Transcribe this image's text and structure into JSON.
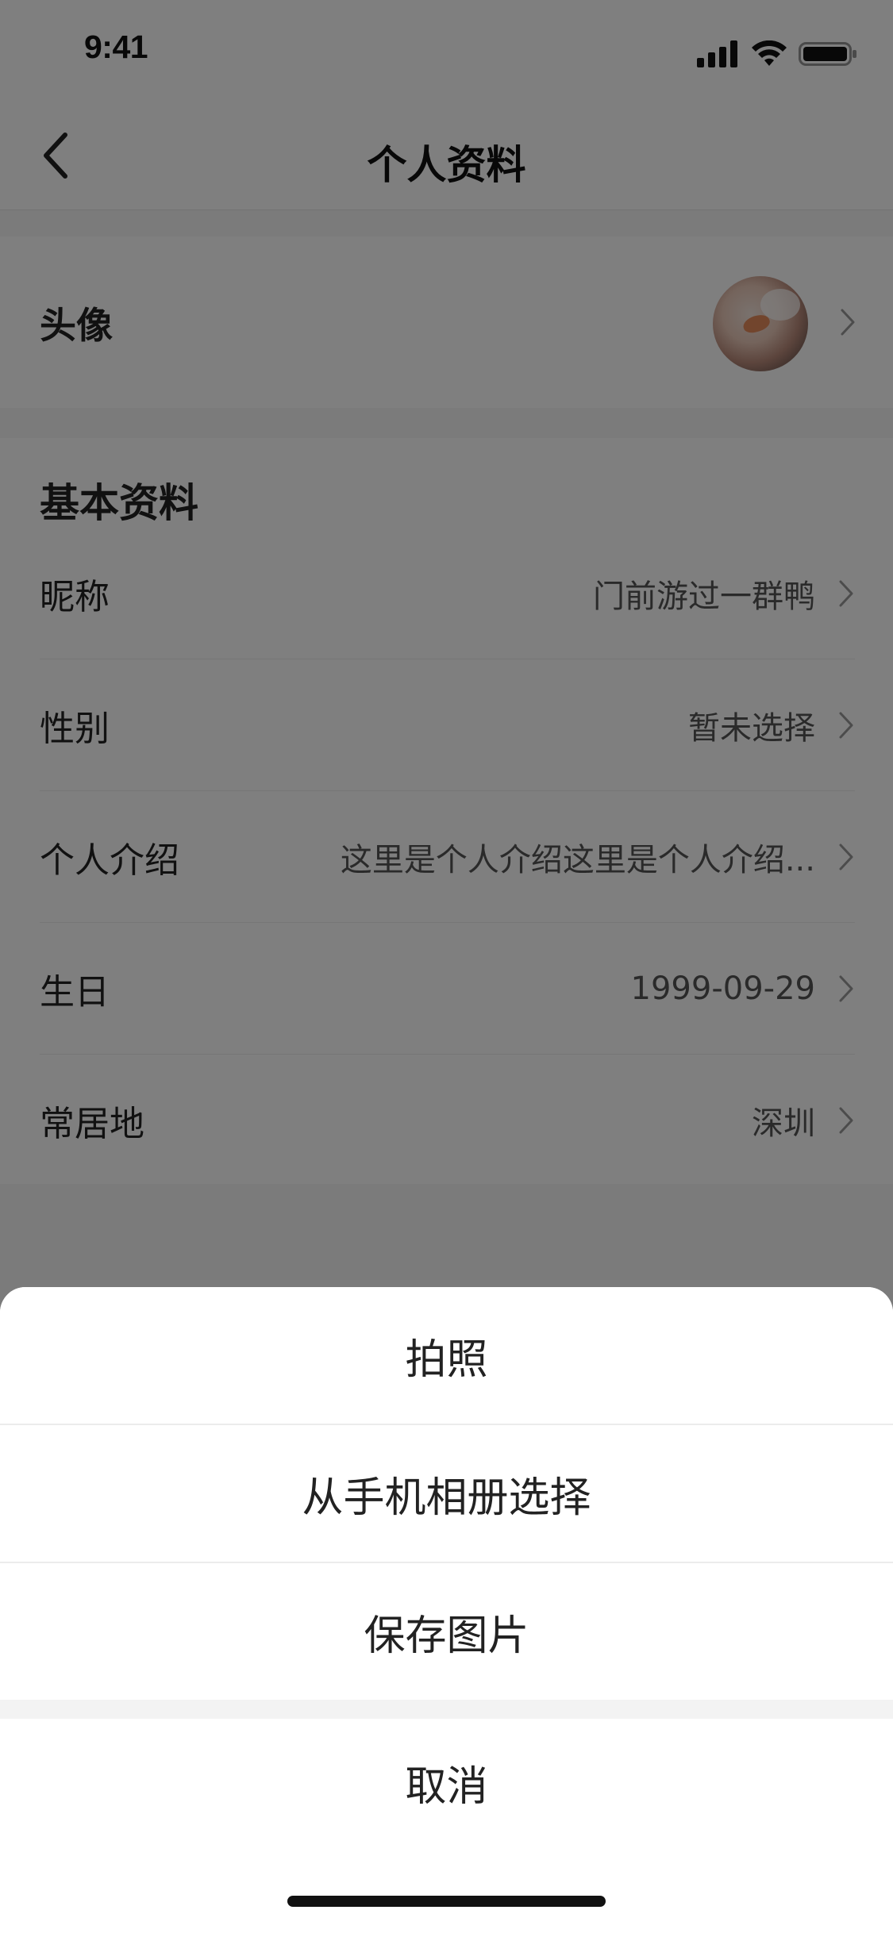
{
  "status_bar": {
    "time": "9:41",
    "icons": [
      "cellular-signal-icon",
      "wifi-icon",
      "battery-icon"
    ]
  },
  "nav": {
    "title": "个人资料",
    "back_icon": "chevron-left-icon"
  },
  "avatar_row": {
    "label": "头像"
  },
  "basic_info": {
    "title": "基本资料",
    "rows": [
      {
        "label": "昵称",
        "value": "门前游过一群鸭"
      },
      {
        "label": "性别",
        "value": "暂未选择"
      },
      {
        "label": "个人介绍",
        "value": "这里是个人介绍这里是个人介绍..."
      },
      {
        "label": "生日",
        "value": "1999-09-29"
      },
      {
        "label": "常居地",
        "value": "深圳"
      }
    ]
  },
  "action_sheet": {
    "options": [
      "拍照",
      "从手机相册选择",
      "保存图片"
    ],
    "cancel": "取消"
  },
  "colors": {
    "overlay": "rgba(0,0,0,0.5)",
    "background": "#f6f6f6",
    "card": "#ffffff",
    "text_primary": "#222222",
    "text_secondary": "#555555",
    "chevron": "#999999"
  }
}
